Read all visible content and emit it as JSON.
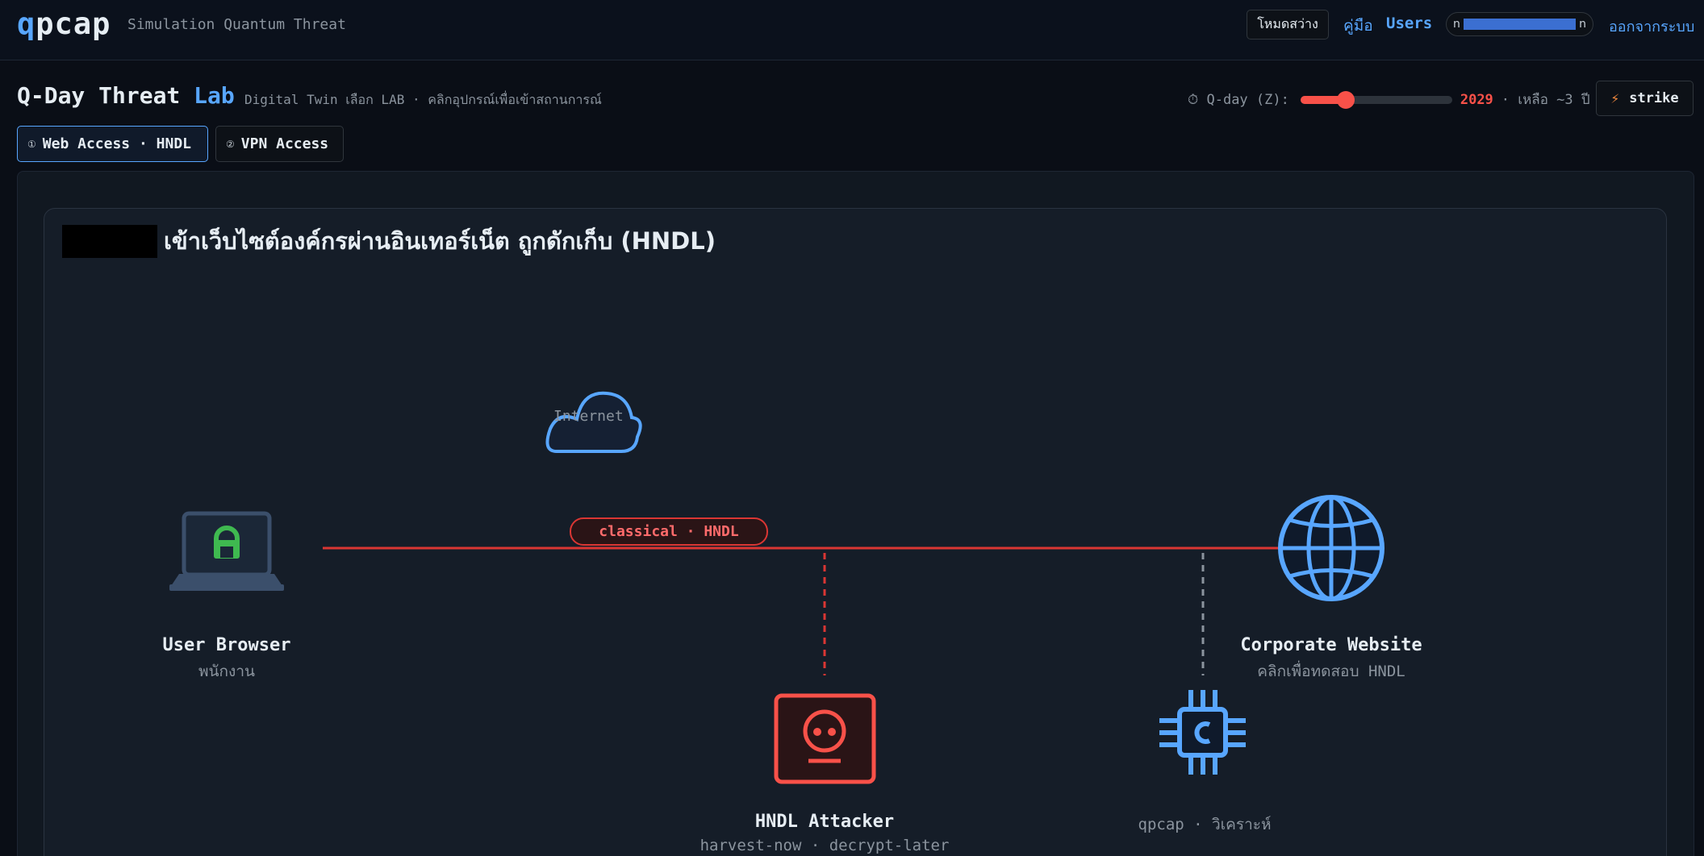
{
  "header": {
    "logo_q": "q",
    "logo_rest": "pcap",
    "tagline": "Simulation Quantum Threat",
    "light_mode_label": "โหมดสว่าง",
    "manual_label": "คู่มือ",
    "users_label": "Users",
    "user_pill_start": "n",
    "user_pill_end": "n",
    "logout_label": "ออกจากระบบ"
  },
  "page": {
    "title_main": "Q-Day Threat",
    "title_accent": "Lab",
    "subtitle": "Digital Twin เลือก LAB · คลิกอุปกรณ์เพื่อเข้าสถานการณ์",
    "qday_label": "⏱ Q-day (Z):",
    "qday_year": "2029",
    "qday_remaining": "· เหลือ ~3 ปี",
    "qday_slider_fraction": 0.3,
    "strike_label": "strike"
  },
  "tabs": [
    {
      "num": "①",
      "label": "Web Access · HNDL",
      "active": true
    },
    {
      "num": "②",
      "label": "VPN Access",
      "active": false
    }
  ],
  "scenario": {
    "title": "เข้าเว็บไซต์องค์กรผ่านอินเทอร์เน็ต ถูกดักเก็บ (HNDL)",
    "cloud_label": "Internet",
    "link_badge": "classical · HNDL",
    "nodes": {
      "user": {
        "label": "User Browser",
        "sub": "พนักงาน"
      },
      "website": {
        "label": "Corporate Website",
        "sub": "คลิกเพื่อทดสอบ HNDL"
      },
      "attacker": {
        "label": "HNDL Attacker",
        "sub": "harvest-now · decrypt-later"
      },
      "qpcap": {
        "label": "",
        "sub": "qpcap · วิเคราะห์"
      }
    },
    "icons": {
      "user": "laptop-lock-icon",
      "website": "globe-icon",
      "attacker": "skull-icon",
      "qpcap": "chip-icon",
      "cloud": "cloud-icon"
    }
  },
  "colors": {
    "accent": "#58a6ff",
    "danger": "#f85149",
    "success": "#3fb950",
    "bg": "#0a0e16"
  }
}
